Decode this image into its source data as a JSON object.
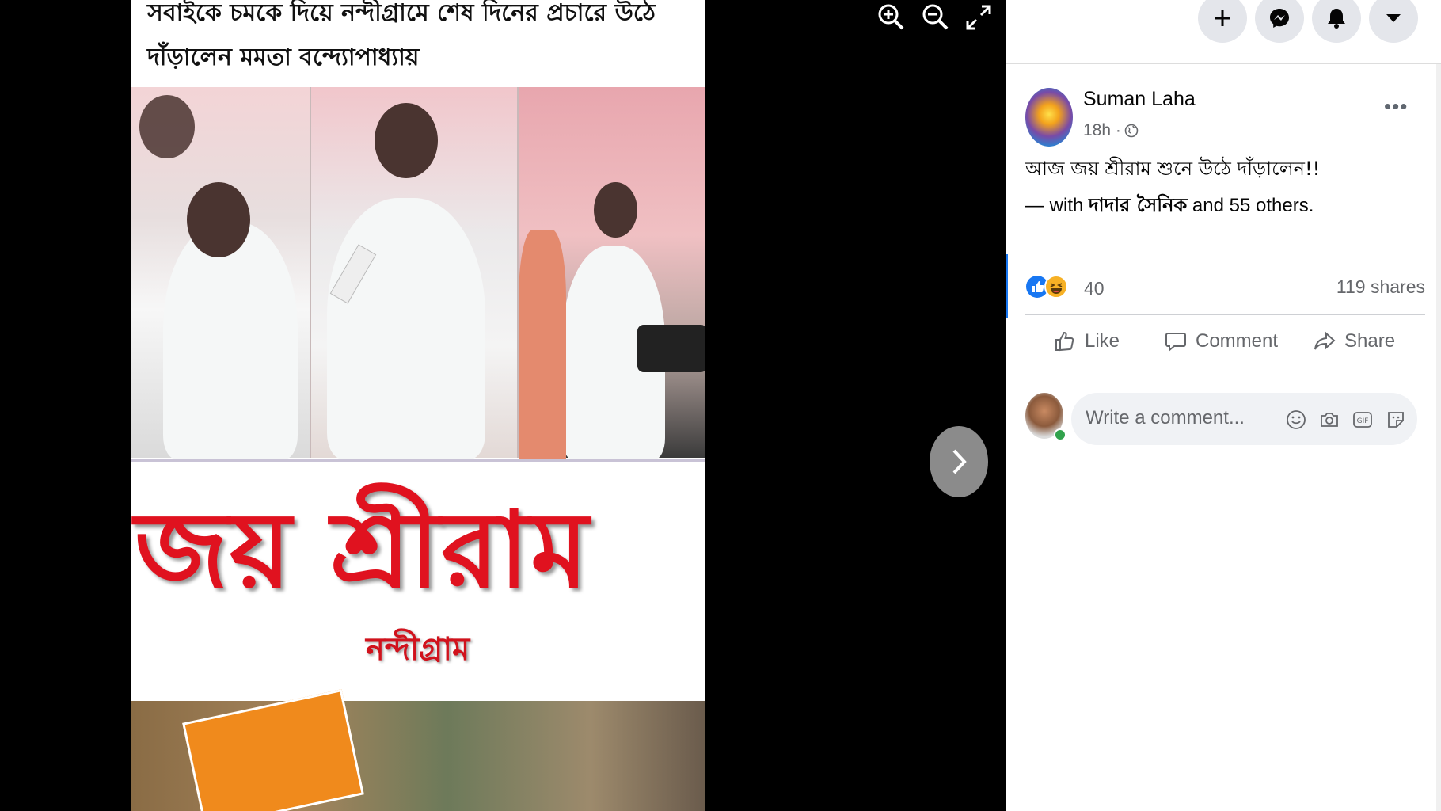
{
  "photo": {
    "caption_line1": "সবাইকে চমকে দিয়ে নন্দীগ্রামে শেষ দিনের প্রচারে উঠে",
    "caption_line2": "দাঁড়ালেন মমতা বন্দ্যোপাধ্যায়",
    "overlay_title": "জয় শ্রীরাম",
    "overlay_subtitle": "নন্দীগ্রাম"
  },
  "viewer": {
    "tools": [
      "zoom-in-icon",
      "zoom-out-icon",
      "fullscreen-icon"
    ],
    "next_icon": "chevron-right-icon"
  },
  "topbar": {
    "buttons": [
      "plus-icon",
      "messenger-icon",
      "bell-icon",
      "caret-down-icon"
    ]
  },
  "post": {
    "author": "Suman Laha",
    "time": "18h ·",
    "text": "আজ জয় শ্রীরাম শুনে উঠে দাঁড়ালেন!!",
    "with_prefix": "— with ",
    "with_tag": "দাদার সৈনিক",
    "with_suffix": " and 55 others.",
    "reaction_count": "40",
    "shares": "119 shares",
    "actions": {
      "like": "Like",
      "comment": "Comment",
      "share": "Share"
    },
    "comment_placeholder": "Write a comment...",
    "more": "•••"
  },
  "colors": {
    "accent": "#1877f2",
    "jai_red": "#e0121f"
  }
}
